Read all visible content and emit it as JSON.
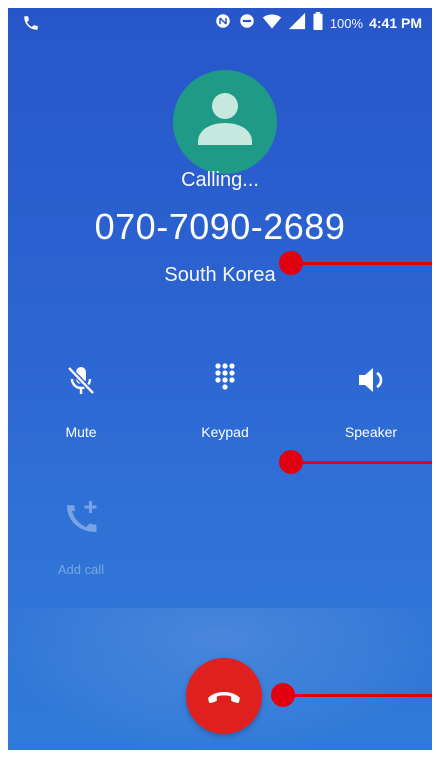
{
  "status_bar": {
    "battery_percent": "100%",
    "time": "4:41 PM",
    "icons": [
      "phone-call-icon",
      "nfc-icon",
      "do-not-disturb-icon",
      "wifi-icon",
      "cell-signal-icon",
      "battery-icon"
    ]
  },
  "call": {
    "status_text": "Calling...",
    "number": "070-7090-2689",
    "location": "South Korea"
  },
  "controls": [
    {
      "label": "Mute",
      "icon": "mic-off-icon"
    },
    {
      "label": "Keypad",
      "icon": "dialpad-icon"
    },
    {
      "label": "Speaker",
      "icon": "speaker-icon"
    },
    {
      "label": "Add call",
      "icon": "add-call-icon"
    }
  ],
  "end_call": {
    "icon": "call-end-icon"
  },
  "colors": {
    "background_top": "#2756c9",
    "background_bottom": "#2f7ad8",
    "avatar": "#1f9a86",
    "end_call": "#e01f1f",
    "annotation": "#e00010"
  }
}
